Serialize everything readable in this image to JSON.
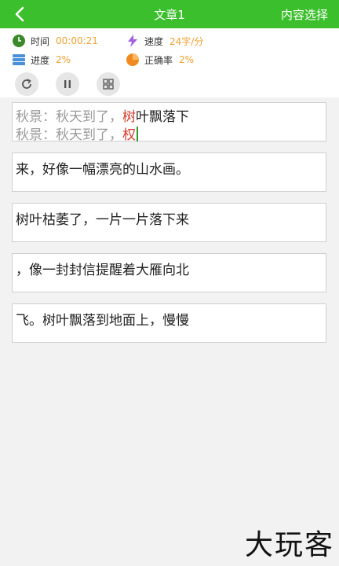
{
  "header": {
    "title": "文章1",
    "choose_label": "内容选择"
  },
  "stats": {
    "time_label": "时间",
    "time_value": "00:00:21",
    "speed_label": "速度",
    "speed_value": "24字/分",
    "progress_label": "进度",
    "progress_value": "2%",
    "accuracy_label": "正确率",
    "accuracy_value": "2%"
  },
  "lines": {
    "l1_prefix": "秋景：秋天到了，",
    "l1_red": "树",
    "l1_rest": "叶飘落下",
    "l2_prefix": "秋景：秋天到了，",
    "l2_red": "权",
    "box2": "来，好像一幅漂亮的山水画。",
    "box3": "树叶枯萎了，一片一片落下来",
    "box4": "，像一封封信提醒着大雁向北",
    "box5": "飞。树叶飘落到地面上，慢慢"
  },
  "watermark": "大玩客"
}
